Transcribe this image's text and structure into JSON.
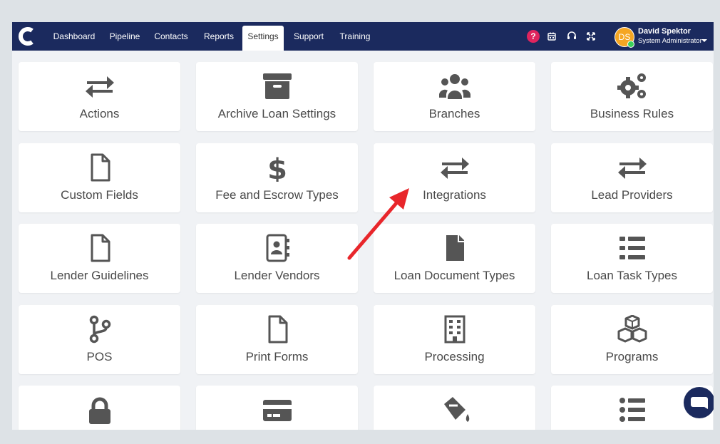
{
  "navbar": {
    "logo": "C",
    "items": [
      {
        "label": "Dashboard"
      },
      {
        "label": "Pipeline"
      },
      {
        "label": "Contacts"
      },
      {
        "label": "Reports"
      },
      {
        "label": "Settings",
        "active": true
      },
      {
        "label": "Support"
      },
      {
        "label": "Training"
      }
    ],
    "help_badge": "?",
    "icons": [
      "help-icon",
      "calendar-icon",
      "headset-icon",
      "expand-icon"
    ],
    "user": {
      "initials": "DS",
      "name": "David Spektor",
      "role": "System Administrator"
    }
  },
  "tiles": [
    {
      "label": "Actions",
      "icon": "exchange-icon"
    },
    {
      "label": "Archive Loan Settings",
      "icon": "archive-box-icon"
    },
    {
      "label": "Branches",
      "icon": "users-group-icon"
    },
    {
      "label": "Business Rules",
      "icon": "gears-icon"
    },
    {
      "label": "Custom Fields",
      "icon": "file-icon"
    },
    {
      "label": "Fee and Escrow Types",
      "icon": "dollar-icon"
    },
    {
      "label": "Integrations",
      "icon": "exchange-icon"
    },
    {
      "label": "Lead Providers",
      "icon": "exchange-icon"
    },
    {
      "label": "Lender Guidelines",
      "icon": "file-icon"
    },
    {
      "label": "Lender Vendors",
      "icon": "address-book-icon"
    },
    {
      "label": "Loan Document Types",
      "icon": "file-solid-icon"
    },
    {
      "label": "Loan Task Types",
      "icon": "list-icon"
    },
    {
      "label": "POS",
      "icon": "code-branch-icon"
    },
    {
      "label": "Print Forms",
      "icon": "file-icon"
    },
    {
      "label": "Processing",
      "icon": "building-icon"
    },
    {
      "label": "Programs",
      "icon": "cubes-icon"
    },
    {
      "label": "",
      "icon": "lock-icon"
    },
    {
      "label": "",
      "icon": "credit-card-icon"
    },
    {
      "label": "",
      "icon": "fill-drip-icon"
    },
    {
      "label": "",
      "icon": "list-ul-icon"
    }
  ],
  "colors": {
    "navbar": "#1b2a5e",
    "icon": "#555555",
    "arrow": "#e8262b",
    "accent": "#f5a623"
  }
}
